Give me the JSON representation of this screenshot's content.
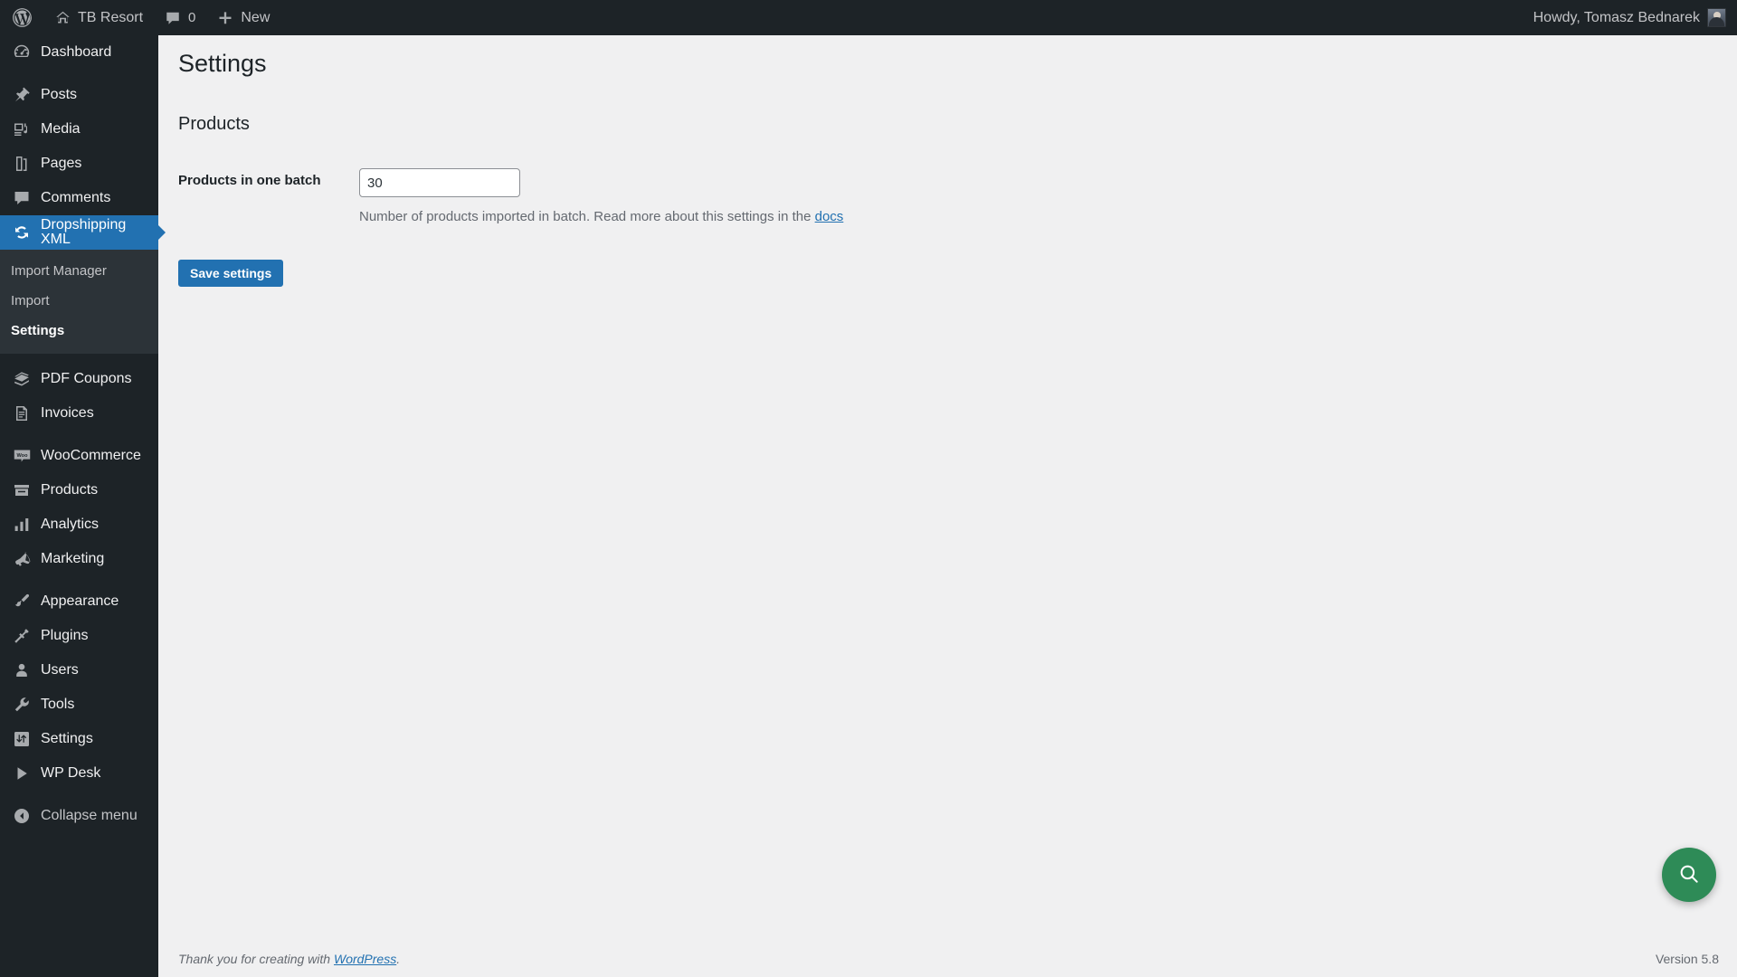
{
  "adminbar": {
    "logo_icon": "wordpress-logo-icon",
    "site_icon": "home-icon",
    "site_name": "TB Resort",
    "comments_icon": "comment-bubble-icon",
    "comments_count": "0",
    "new_icon": "plus-icon",
    "new_label": "New",
    "howdy": "Howdy, Tomasz Bednarek",
    "avatar_name": "user-avatar"
  },
  "sidebar": {
    "items": [
      {
        "label": "Dashboard",
        "icon": "dashboard-icon",
        "name": "dashboard",
        "current": false,
        "separator_after": true
      },
      {
        "label": "Posts",
        "icon": "pin-icon",
        "name": "posts",
        "current": false,
        "separator_after": false
      },
      {
        "label": "Media",
        "icon": "media-icon",
        "name": "media",
        "current": false,
        "separator_after": false
      },
      {
        "label": "Pages",
        "icon": "pages-icon",
        "name": "pages",
        "current": false,
        "separator_after": false
      },
      {
        "label": "Comments",
        "icon": "comment-bubble-icon",
        "name": "comments",
        "current": false,
        "separator_after": false
      },
      {
        "label": "Dropshipping XML",
        "icon": "sync-arrows-icon",
        "name": "dropshipping-xml",
        "current": true,
        "separator_after": false
      }
    ],
    "submenu": {
      "parent": "Dropshipping XML",
      "items": [
        {
          "label": "Import Manager",
          "name": "import-manager",
          "current": false
        },
        {
          "label": "Import",
          "name": "import",
          "current": false
        },
        {
          "label": "Settings",
          "name": "settings",
          "current": true
        }
      ]
    },
    "items_after": [
      {
        "label": "PDF Coupons",
        "icon": "coupons-icon",
        "name": "pdf-coupons",
        "current": false,
        "separator_after": false
      },
      {
        "label": "Invoices",
        "icon": "invoice-document-icon",
        "name": "invoices",
        "current": false,
        "separator_after": true
      },
      {
        "label": "WooCommerce",
        "icon": "woocommerce-icon",
        "name": "woocommerce",
        "current": false,
        "separator_after": false
      },
      {
        "label": "Products",
        "icon": "products-box-icon",
        "name": "products",
        "current": false,
        "separator_after": false
      },
      {
        "label": "Analytics",
        "icon": "bar-chart-icon",
        "name": "analytics",
        "current": false,
        "separator_after": false
      },
      {
        "label": "Marketing",
        "icon": "megaphone-icon",
        "name": "marketing",
        "current": false,
        "separator_after": true
      },
      {
        "label": "Appearance",
        "icon": "paintbrush-icon",
        "name": "appearance",
        "current": false,
        "separator_after": false
      },
      {
        "label": "Plugins",
        "icon": "plug-icon",
        "name": "plugins",
        "current": false,
        "separator_after": false
      },
      {
        "label": "Users",
        "icon": "user-icon",
        "name": "users",
        "current": false,
        "separator_after": false
      },
      {
        "label": "Tools",
        "icon": "wrench-icon",
        "name": "tools",
        "current": false,
        "separator_after": false
      },
      {
        "label": "Settings",
        "icon": "sliders-icon",
        "name": "settings",
        "current": false,
        "separator_after": false
      },
      {
        "label": "WP Desk",
        "icon": "play-triangle-icon",
        "name": "wp-desk",
        "current": false,
        "separator_after": true
      }
    ],
    "collapse": {
      "label": "Collapse menu",
      "icon": "collapse-arrow-icon",
      "name": "collapse-menu"
    }
  },
  "main": {
    "page_title": "Settings",
    "section_title": "Products",
    "field": {
      "label": "Products in one batch",
      "value": "30",
      "placeholder": "",
      "description_before": "Number of products imported in batch. Read more about this settings in the ",
      "description_link": "docs",
      "description_after": ""
    },
    "save_label": "Save settings"
  },
  "fab": {
    "icon": "search-magnifier-icon",
    "name": "help-search-button",
    "color": "#2e8b57"
  },
  "footer": {
    "thanks_before": "Thank you for creating with ",
    "thanks_link": "WordPress",
    "thanks_after": ".",
    "version": "Version 5.8"
  },
  "colors": {
    "admin_bar": "#1d2327",
    "sidebar": "#1d2327",
    "submenu_bg": "#2c3338",
    "accent_blue": "#2271b1",
    "content_bg": "#f0f0f1",
    "link": "#2271b1",
    "fab_green": "#2e8b57"
  }
}
